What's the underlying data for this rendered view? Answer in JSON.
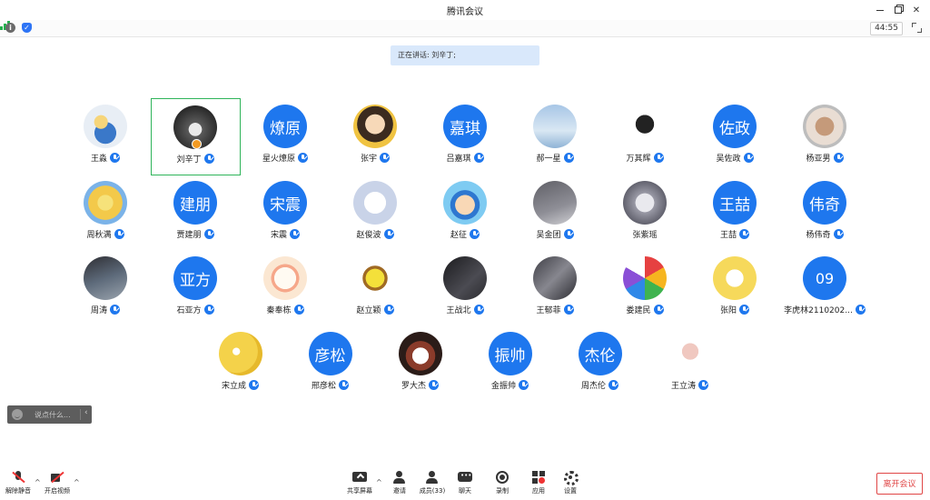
{
  "window": {
    "title": "腾讯会议"
  },
  "infobar": {
    "timer": "44:55"
  },
  "speaking": {
    "label": "正在讲话:",
    "name": "刘辛丁;"
  },
  "participants": {
    "row1": [
      {
        "name": "王淼",
        "avatar_text": "",
        "avatar": "cartoon-character"
      },
      {
        "name": "刘辛丁",
        "avatar_text": "",
        "avatar": "photo",
        "active": true
      },
      {
        "name": "星火燎原",
        "avatar_text": "燎原"
      },
      {
        "name": "张宇",
        "avatar_text": "",
        "avatar": "photo"
      },
      {
        "name": "吕嘉琪",
        "avatar_text": "嘉琪"
      },
      {
        "name": "郝一星",
        "avatar_text": "",
        "avatar": "photo"
      },
      {
        "name": "万其辉",
        "avatar_text": "",
        "avatar": "photo"
      },
      {
        "name": "吴佐政",
        "avatar_text": "佐政"
      },
      {
        "name": "杨亚男",
        "avatar_text": "",
        "avatar": "cartoon"
      }
    ],
    "row2": [
      {
        "name": "周秋满",
        "avatar_text": "",
        "avatar": "cartoon"
      },
      {
        "name": "贾建朋",
        "avatar_text": "建朋"
      },
      {
        "name": "宋震",
        "avatar_text": "宋震"
      },
      {
        "name": "赵俊波",
        "avatar_text": "",
        "avatar": "cartoon"
      },
      {
        "name": "赵征",
        "avatar_text": "",
        "avatar": "cartoon"
      },
      {
        "name": "吴金团",
        "avatar_text": "",
        "avatar": "photo"
      },
      {
        "name": "张紫瑶",
        "avatar_text": "",
        "avatar": "photo"
      },
      {
        "name": "王喆",
        "avatar_text": "王喆"
      },
      {
        "name": "杨伟奇",
        "avatar_text": "伟奇"
      }
    ],
    "row3": [
      {
        "name": "周涛",
        "avatar_text": "",
        "avatar": "photo"
      },
      {
        "name": "石亚方",
        "avatar_text": "亚方"
      },
      {
        "name": "秦奉栋",
        "avatar_text": "",
        "avatar": "cartoon"
      },
      {
        "name": "赵立颖",
        "avatar_text": "",
        "avatar": "cartoon"
      },
      {
        "name": "王战北",
        "avatar_text": "",
        "avatar": "photo"
      },
      {
        "name": "王郁菲",
        "avatar_text": "",
        "avatar": "photo"
      },
      {
        "name": "娄建民",
        "avatar_text": "",
        "avatar": "cartoon"
      },
      {
        "name": "张阳",
        "avatar_text": "",
        "avatar": "cartoon"
      },
      {
        "name": "李虎林2110202...",
        "avatar_text": "09"
      }
    ],
    "row4": [
      {
        "name": "宋立成",
        "avatar_text": "",
        "avatar": "cartoon"
      },
      {
        "name": "邢彦松",
        "avatar_text": "彦松"
      },
      {
        "name": "罗大杰",
        "avatar_text": "",
        "avatar": "photo"
      },
      {
        "name": "金振帅",
        "avatar_text": "振帅"
      },
      {
        "name": "周杰伦",
        "avatar_text": "杰伦"
      },
      {
        "name": "王立涛",
        "avatar_text": "",
        "avatar": "cartoon"
      }
    ]
  },
  "chat": {
    "placeholder": "说点什么..."
  },
  "toolbar": {
    "unmute": "解除静音",
    "start_video": "开启视频",
    "share_screen": "共享屏幕",
    "invite": "邀请",
    "members": "成员(33)",
    "chat": "聊天",
    "record": "录制",
    "apps": "应用",
    "settings": "设置",
    "leave": "离开会议"
  },
  "colors": {
    "avatar_blue": "#1e77ee",
    "active_border": "#2fb45a",
    "leave_red": "#e04646",
    "speaking_bg": "#d9e8fb"
  }
}
